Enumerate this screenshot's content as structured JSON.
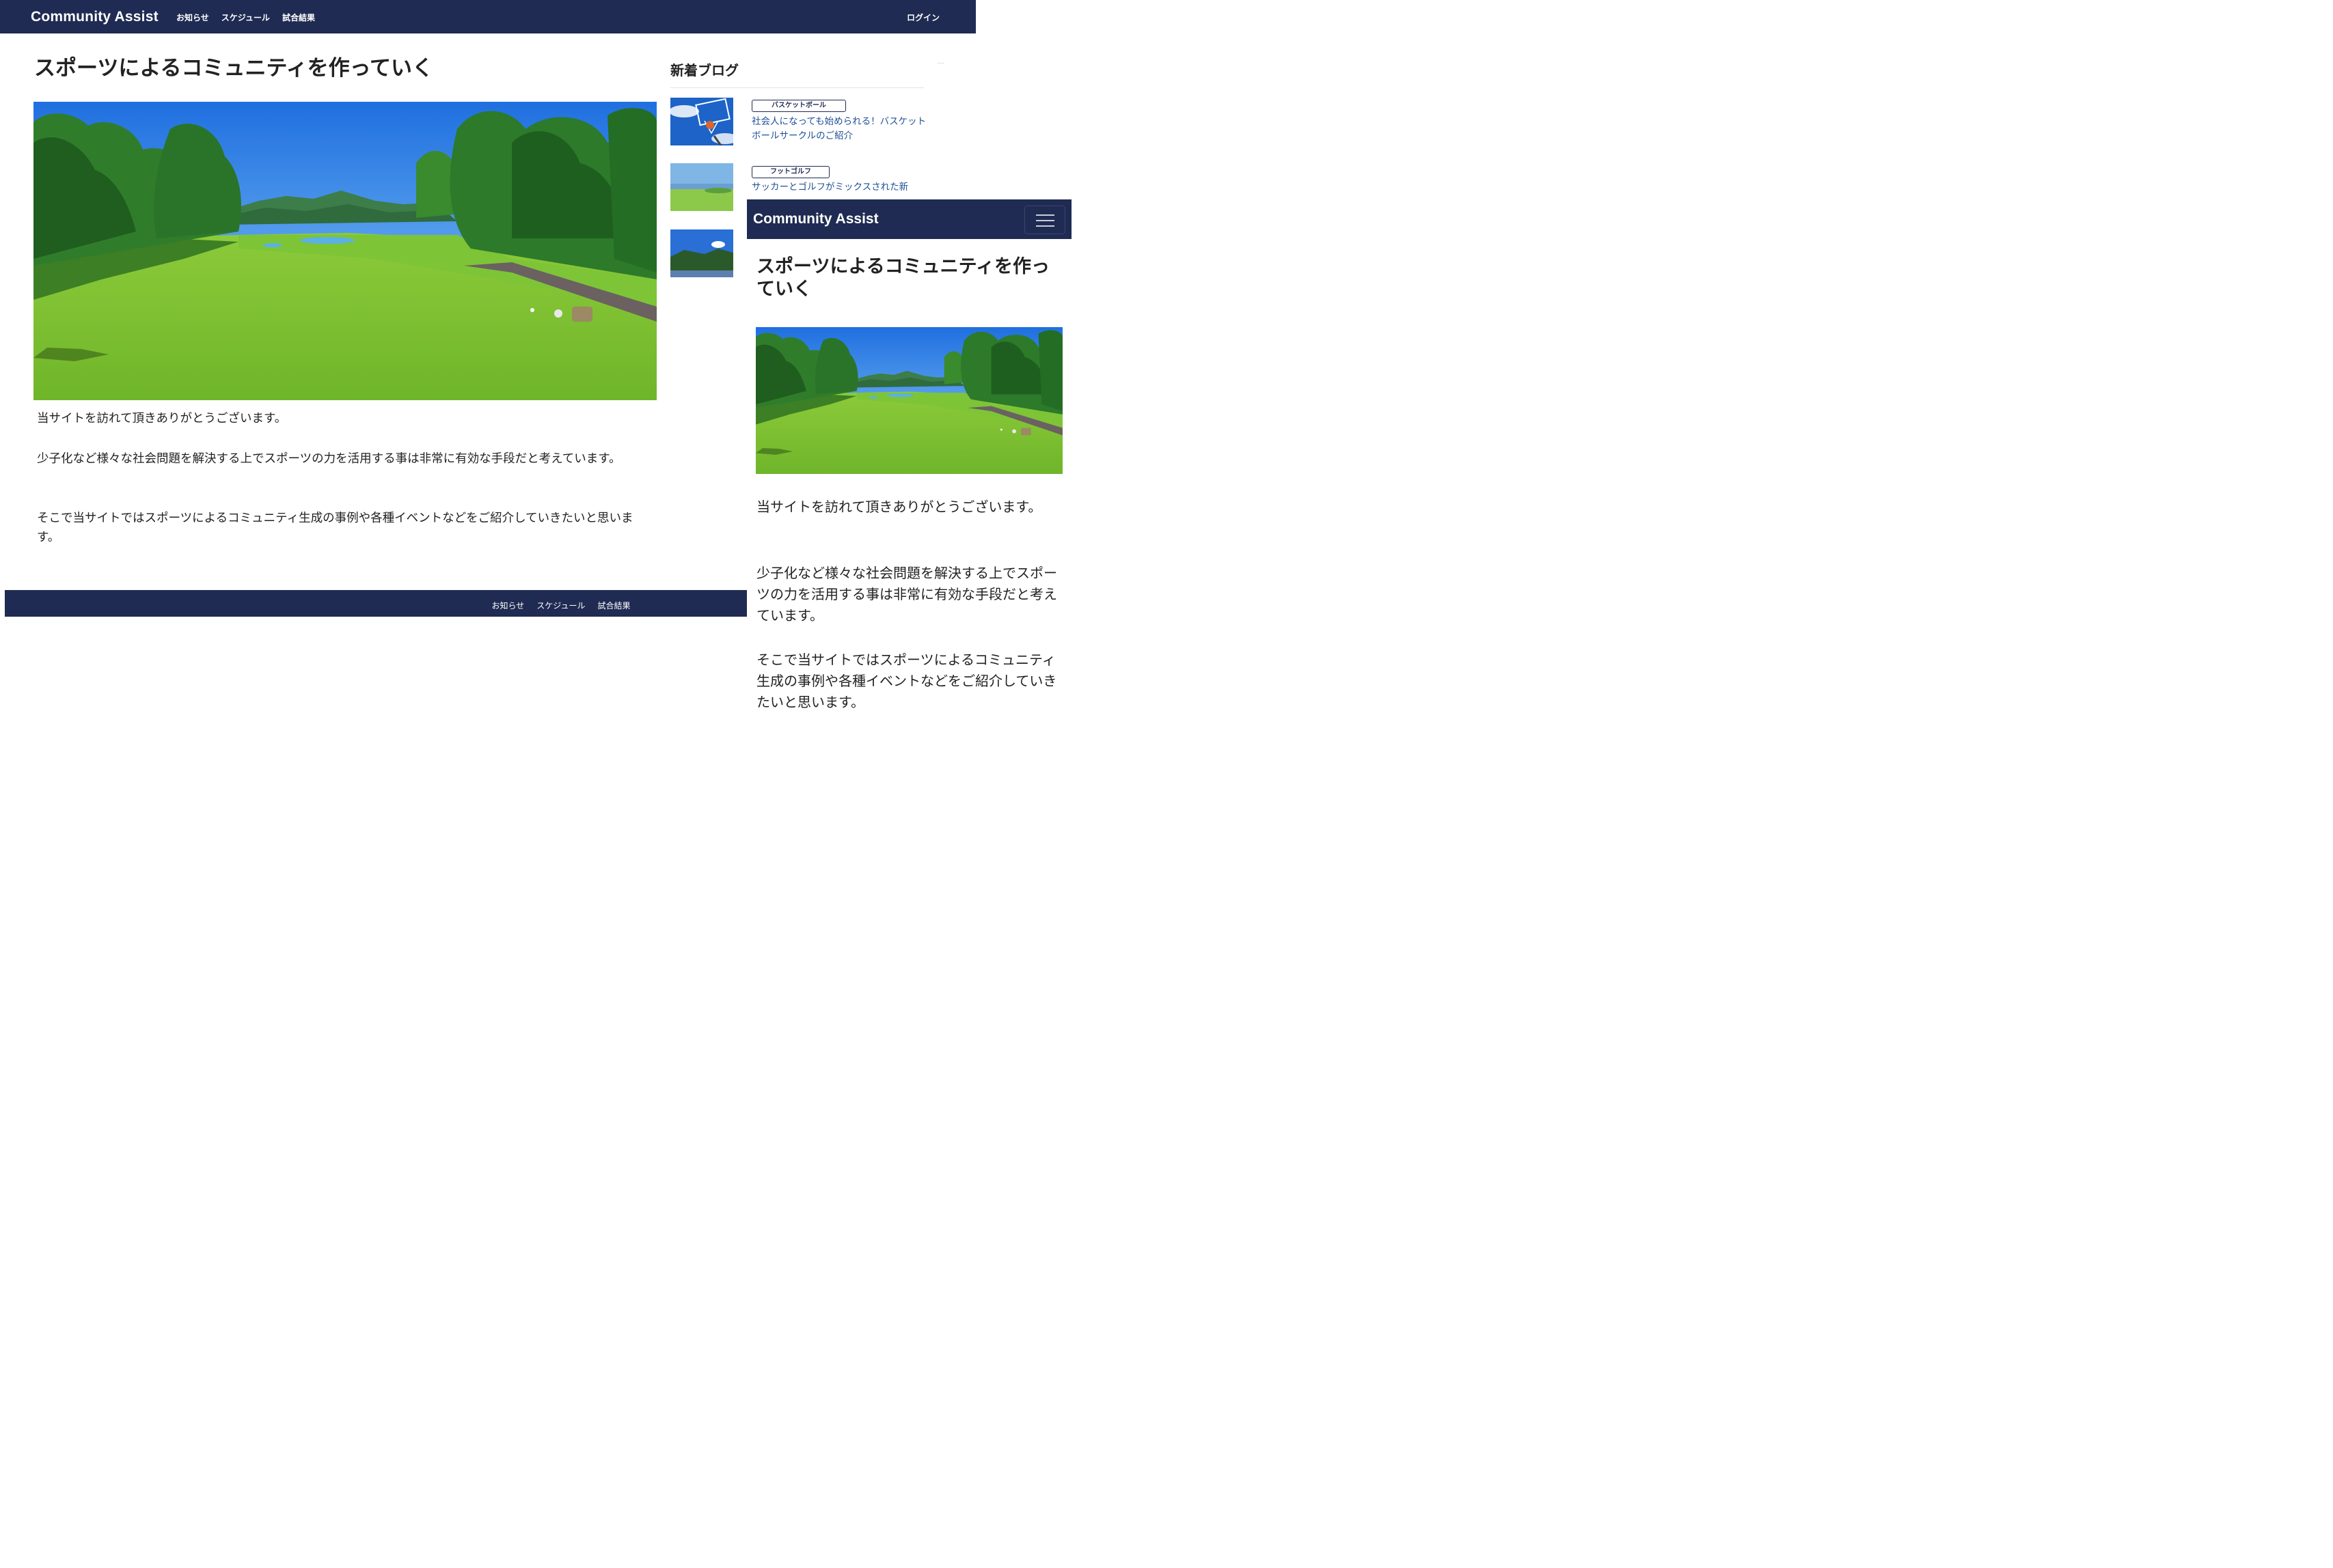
{
  "desktop": {
    "navbar": {
      "brand": "Community Assist",
      "links": [
        "お知らせ",
        "スケジュール",
        "試合結果"
      ],
      "login": "ログイン"
    },
    "main": {
      "title": "スポーツによるコミュニティを作っていく",
      "hero_image": "golf-course-photo",
      "paragraphs": [
        "当サイトを訪れて頂きありがとうございます。",
        "少子化など様々な社会問題を解決する上でスポーツの力を活用する事は非常に有効な手段だと考えています。",
        "そこで当サイトではスポーツによるコミュニティ生成の事例や各種イベントなどをご紹介していきたいと思います。"
      ]
    },
    "sidebar": {
      "title": "新着ブログ",
      "posts": [
        {
          "category": "バスケットボール",
          "title": "社会人になっても始められる！バスケットボールサークルのご紹介",
          "thumbnail": "basketball-hoop-photo"
        },
        {
          "category": "フットゴルフ",
          "title": "サッカーとゴルフがミックスされた新",
          "thumbnail": "coastal-field-photo"
        },
        {
          "category": "",
          "title": "",
          "thumbnail": "tennis-court-photo"
        }
      ]
    },
    "footer": {
      "links": [
        "お知らせ",
        "スケジュール",
        "試合結果"
      ]
    }
  },
  "mobile": {
    "navbar": {
      "brand": "Community Assist",
      "toggler_icon": "hamburger-icon"
    },
    "main": {
      "title": "スポーツによるコミュニティを作っていく",
      "hero_image": "golf-course-photo",
      "paragraphs": [
        "当サイトを訪れて頂きありがとうございます。",
        "少子化など様々な社会問題を解決する上でスポーツの力を活用する事は非常に有効な手段だと考えています。",
        "そこで当サイトではスポーツによるコミュニティ生成の事例や各種イベントなどをご紹介していきたいと思います。"
      ]
    }
  },
  "colors": {
    "navy": "#1f2b52",
    "link_blue": "#1d4f95",
    "text": "#222222",
    "background": "#ffffff"
  }
}
